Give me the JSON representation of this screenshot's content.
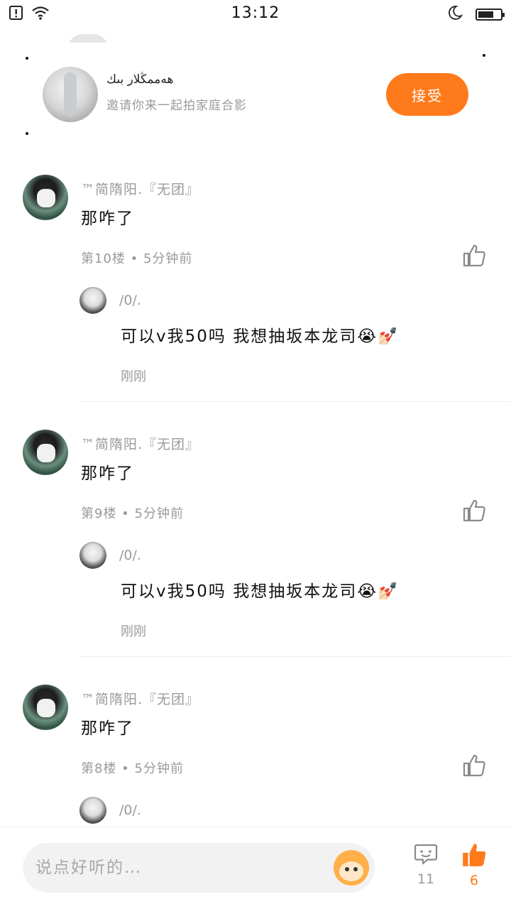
{
  "status_bar": {
    "time": "13:12",
    "battery_level": 0.7
  },
  "invite": {
    "name": "ھەممڭلار بىك",
    "description": "邀请你来一起拍家庭合影",
    "accept_label": "接受"
  },
  "comments": [
    {
      "author": "™简隋阳.『无团』",
      "text": "那咋了",
      "meta": "第10楼 • 5分钟前",
      "reply": {
        "author": "/0/.",
        "text": "可以v我50吗 我想抽坂本龙司😭💅🏻",
        "time": "刚刚"
      }
    },
    {
      "author": "™简隋阳.『无团』",
      "text": "那咋了",
      "meta": "第9楼 • 5分钟前",
      "reply": {
        "author": "/0/.",
        "text": "可以v我50吗 我想抽坂本龙司😭💅🏻",
        "time": "刚刚"
      }
    },
    {
      "author": "™简隋阳.『无团』",
      "text": "那咋了",
      "meta": "第8楼 • 5分钟前",
      "reply": {
        "author": "/0/.",
        "text": "",
        "time": ""
      }
    }
  ],
  "bottom_bar": {
    "input_placeholder": "说点好听的…",
    "comment_count": "11",
    "like_count": "6"
  },
  "colors": {
    "accent": "#ff7a1a",
    "muted_text": "#9a9a9a"
  },
  "icons": [
    "notification-icon",
    "wifi-icon",
    "moon-icon",
    "battery-icon",
    "thumbs-up-icon",
    "comment-icon",
    "mascot-icon"
  ]
}
